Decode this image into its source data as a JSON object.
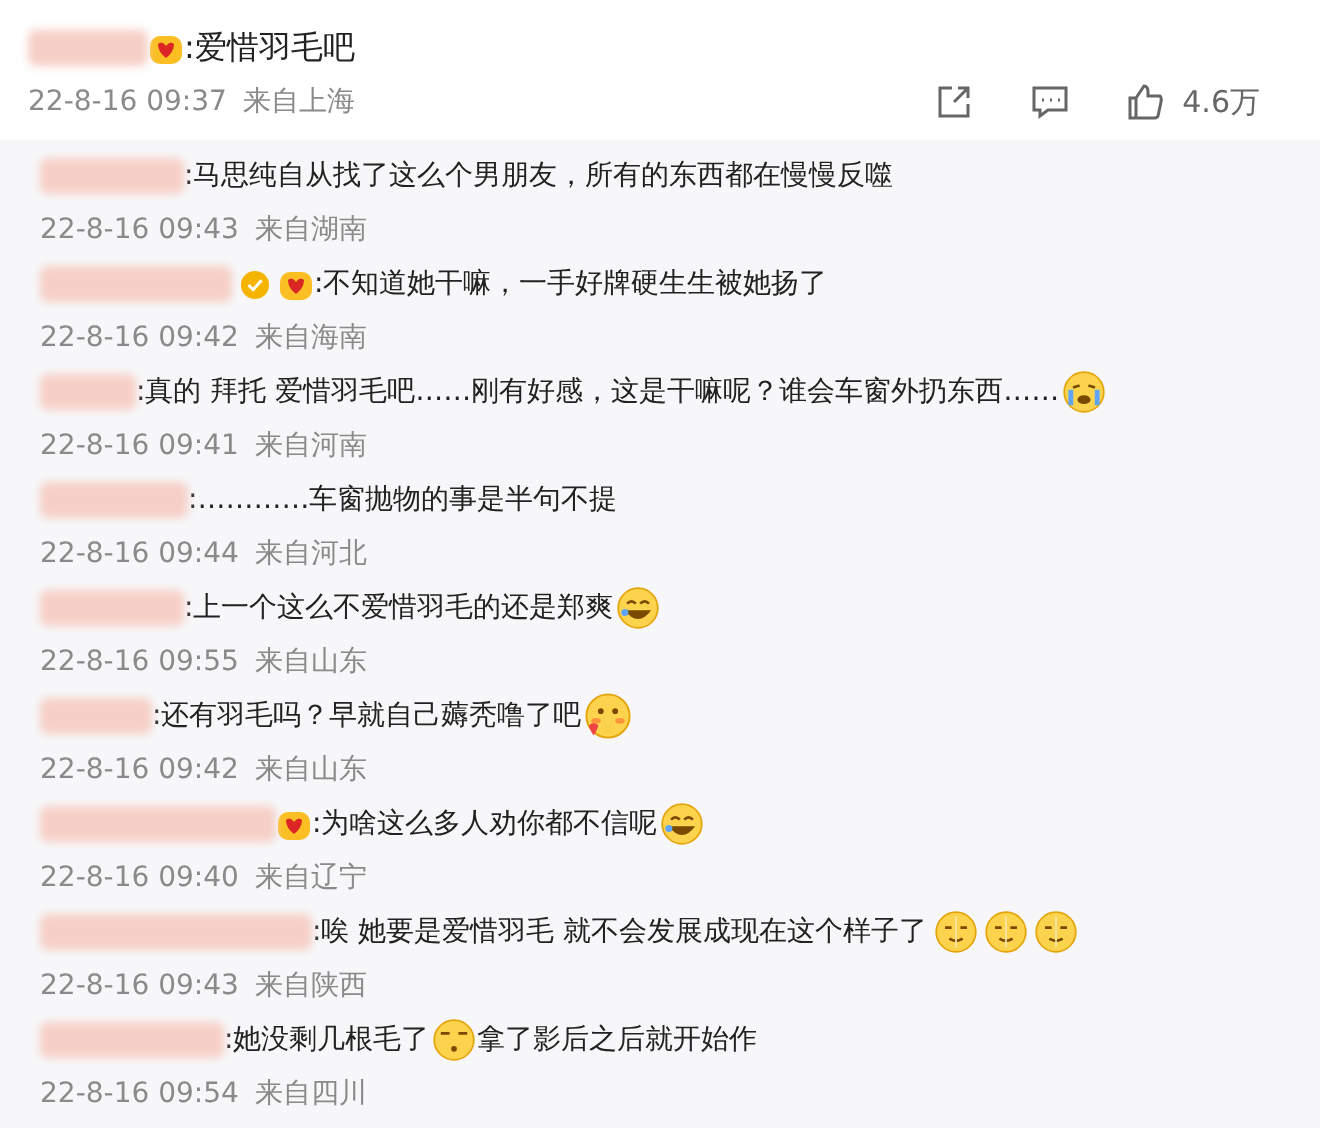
{
  "top_comment": {
    "badges": [
      {
        "kind": "member"
      }
    ],
    "parts": [
      {
        "kind": "text",
        "text": ":爱惜羽毛吧"
      }
    ],
    "time": "22-8-16 09:37",
    "location": "来自上海",
    "likes": "4.6万"
  },
  "replies": [
    {
      "parts": [
        {
          "kind": "text",
          "text": ":马思纯自从找了这么个男朋友，所有的东西都在慢慢反噬"
        }
      ],
      "time": "22-8-16 09:43",
      "location": "来自湖南"
    },
    {
      "badges": [
        {
          "kind": "verified"
        },
        {
          "kind": "member"
        }
      ],
      "parts": [
        {
          "kind": "text",
          "text": ":不知道她干嘛，一手好牌硬生生被她扬了"
        }
      ],
      "time": "22-8-16 09:42",
      "location": "来自海南"
    },
    {
      "parts": [
        {
          "kind": "text",
          "text": ":真的 拜托 爱惜羽毛吧……刚有好感，这是干嘛呢？谁会车窗外扔东西……"
        },
        {
          "kind": "cry"
        }
      ],
      "time": "22-8-16 09:41",
      "location": "来自河南"
    },
    {
      "parts": [
        {
          "kind": "text",
          "text": ":…………车窗抛物的事是半句不提"
        }
      ],
      "time": "22-8-16 09:44",
      "location": "来自河北"
    },
    {
      "parts": [
        {
          "kind": "text",
          "text": ":上一个这么不爱惜羽毛的还是郑爽"
        },
        {
          "kind": "laugh"
        }
      ],
      "time": "22-8-16 09:55",
      "location": "来自山东"
    },
    {
      "parts": [
        {
          "kind": "text",
          "text": ":还有羽毛吗？早就自己薅秃噜了吧"
        },
        {
          "kind": "blush"
        }
      ],
      "time": "22-8-16 09:42",
      "location": "来自山东"
    },
    {
      "badges": [
        {
          "kind": "member"
        }
      ],
      "parts": [
        {
          "kind": "text",
          "text": ":为啥这么多人劝你都不信呢"
        },
        {
          "kind": "laugh"
        }
      ],
      "time": "22-8-16 09:40",
      "location": "来自辽宁"
    },
    {
      "parts": [
        {
          "kind": "text",
          "text": ":唉 她要是爱惜羽毛 就不会发展成现在这个样子了"
        },
        {
          "kind": "smirk"
        },
        {
          "kind": "smirk"
        },
        {
          "kind": "smirk"
        }
      ],
      "time": "22-8-16 09:43",
      "location": "来自陕西"
    },
    {
      "parts": [
        {
          "kind": "text",
          "text": ":她没剩几根毛了"
        },
        {
          "kind": "sleepy"
        },
        {
          "kind": "text",
          "text": "拿了影后之后就开始作"
        }
      ],
      "time": "22-8-16 09:54",
      "location": "来自四川"
    }
  ]
}
